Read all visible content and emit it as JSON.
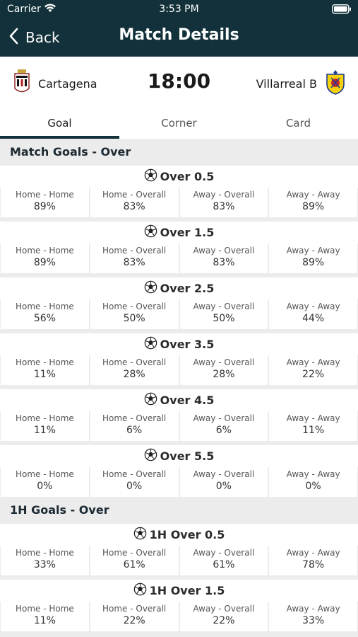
{
  "status_bar": {
    "carrier": "Carrier",
    "time": "3:53 PM"
  },
  "nav": {
    "back_label": "Back",
    "title": "Match Details"
  },
  "match": {
    "home_team": "Cartagena",
    "away_team": "Villarreal B",
    "kickoff": "18:00"
  },
  "tabs": [
    {
      "label": "Goal",
      "active": true
    },
    {
      "label": "Corner",
      "active": false
    },
    {
      "label": "Card",
      "active": false
    }
  ],
  "labels": {
    "home_home": "Home - Home",
    "home_overall": "Home - Overall",
    "away_overall": "Away - Overall",
    "away_away": "Away - Away"
  },
  "sections": [
    {
      "title": "Match Goals - Over",
      "groups": [
        {
          "title": "Over 0.5",
          "values": [
            "89%",
            "83%",
            "83%",
            "89%"
          ]
        },
        {
          "title": "Over 1.5",
          "values": [
            "89%",
            "83%",
            "83%",
            "89%"
          ]
        },
        {
          "title": "Over 2.5",
          "values": [
            "56%",
            "50%",
            "50%",
            "44%"
          ]
        },
        {
          "title": "Over 3.5",
          "values": [
            "11%",
            "28%",
            "28%",
            "22%"
          ]
        },
        {
          "title": "Over 4.5",
          "values": [
            "11%",
            "6%",
            "6%",
            "11%"
          ]
        },
        {
          "title": "Over 5.5",
          "values": [
            "0%",
            "0%",
            "0%",
            "0%"
          ]
        }
      ]
    },
    {
      "title": "1H Goals - Over",
      "groups": [
        {
          "title": "1H Over 0.5",
          "values": [
            "33%",
            "61%",
            "61%",
            "78%"
          ]
        },
        {
          "title": "1H Over 1.5",
          "values": [
            "11%",
            "22%",
            "22%",
            "33%"
          ]
        }
      ]
    }
  ],
  "icons": {
    "group": "soccer-ball-icon"
  },
  "colors": {
    "header": "#12313a",
    "tab_indicator": "#12313a"
  }
}
